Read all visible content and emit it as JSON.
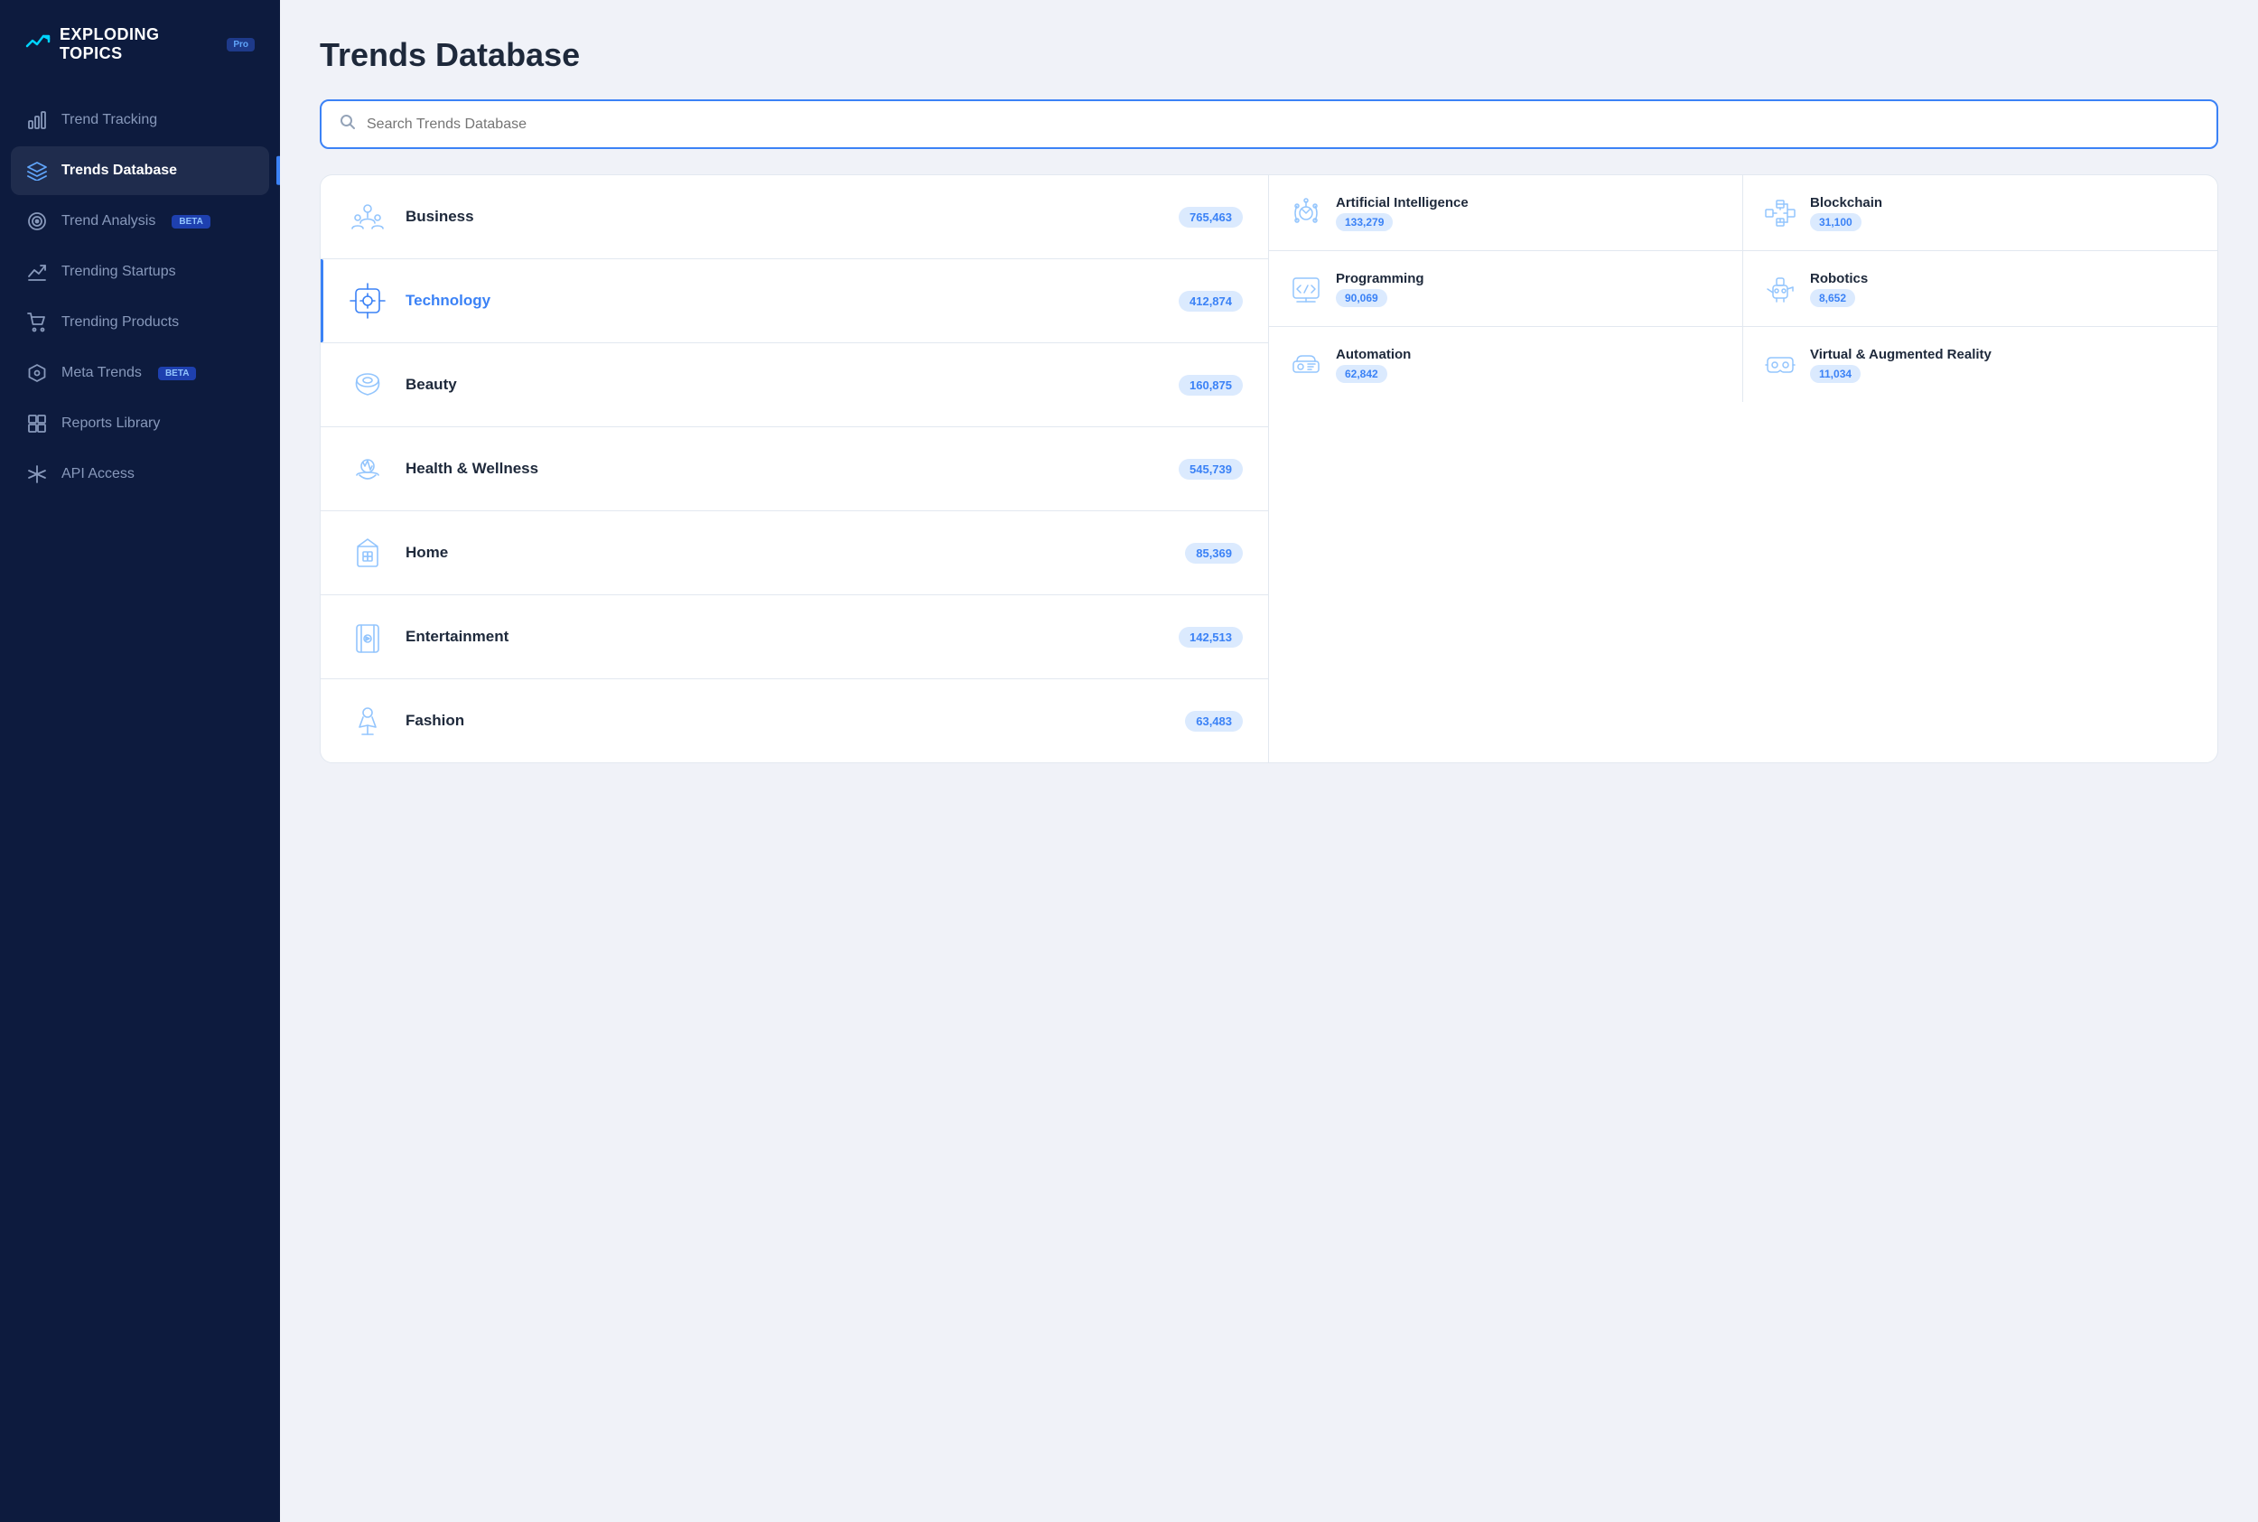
{
  "app": {
    "logo_text": "EXPLODING TOPICS",
    "logo_badge": "Pro"
  },
  "sidebar": {
    "items": [
      {
        "id": "trend-tracking",
        "label": "Trend Tracking",
        "icon": "chart-icon",
        "active": false,
        "beta": false
      },
      {
        "id": "trends-database",
        "label": "Trends Database",
        "icon": "layers-icon",
        "active": true,
        "beta": false
      },
      {
        "id": "trend-analysis",
        "label": "Trend Analysis",
        "icon": "target-icon",
        "active": false,
        "beta": true
      },
      {
        "id": "trending-startups",
        "label": "Trending Startups",
        "icon": "line-chart-icon",
        "active": false,
        "beta": false
      },
      {
        "id": "trending-products",
        "label": "Trending Products",
        "icon": "cart-icon",
        "active": false,
        "beta": false
      },
      {
        "id": "meta-trends",
        "label": "Meta Trends",
        "icon": "hexagon-icon",
        "active": false,
        "beta": true
      },
      {
        "id": "reports-library",
        "label": "Reports Library",
        "icon": "grid-icon",
        "active": false,
        "beta": false
      },
      {
        "id": "api-access",
        "label": "API Access",
        "icon": "asterisk-icon",
        "active": false,
        "beta": false
      }
    ]
  },
  "main": {
    "page_title": "Trends Database",
    "search_placeholder": "Search Trends Database"
  },
  "categories": {
    "left": [
      {
        "id": "business",
        "name": "Business",
        "count": "765,463",
        "active": false
      },
      {
        "id": "technology",
        "name": "Technology",
        "count": "412,874",
        "active": true
      },
      {
        "id": "beauty",
        "name": "Beauty",
        "count": "160,875",
        "active": false
      },
      {
        "id": "health-wellness",
        "name": "Health & Wellness",
        "count": "545,739",
        "active": false
      },
      {
        "id": "home",
        "name": "Home",
        "count": "85,369",
        "active": false
      },
      {
        "id": "entertainment",
        "name": "Entertainment",
        "count": "142,513",
        "active": false
      },
      {
        "id": "fashion",
        "name": "Fashion",
        "count": "63,483",
        "active": false
      }
    ],
    "right": [
      [
        {
          "id": "ai",
          "name": "Artificial Intelligence",
          "count": "133,279"
        },
        {
          "id": "blockchain",
          "name": "Blockchain",
          "count": "31,100"
        }
      ],
      [
        {
          "id": "programming",
          "name": "Programming",
          "count": "90,069"
        },
        {
          "id": "robotics",
          "name": "Robotics",
          "count": "8,652"
        }
      ],
      [
        {
          "id": "automation",
          "name": "Automation",
          "count": "62,842"
        },
        {
          "id": "vr",
          "name": "Virtual & Augmented Reality",
          "count": "11,034"
        }
      ]
    ]
  }
}
